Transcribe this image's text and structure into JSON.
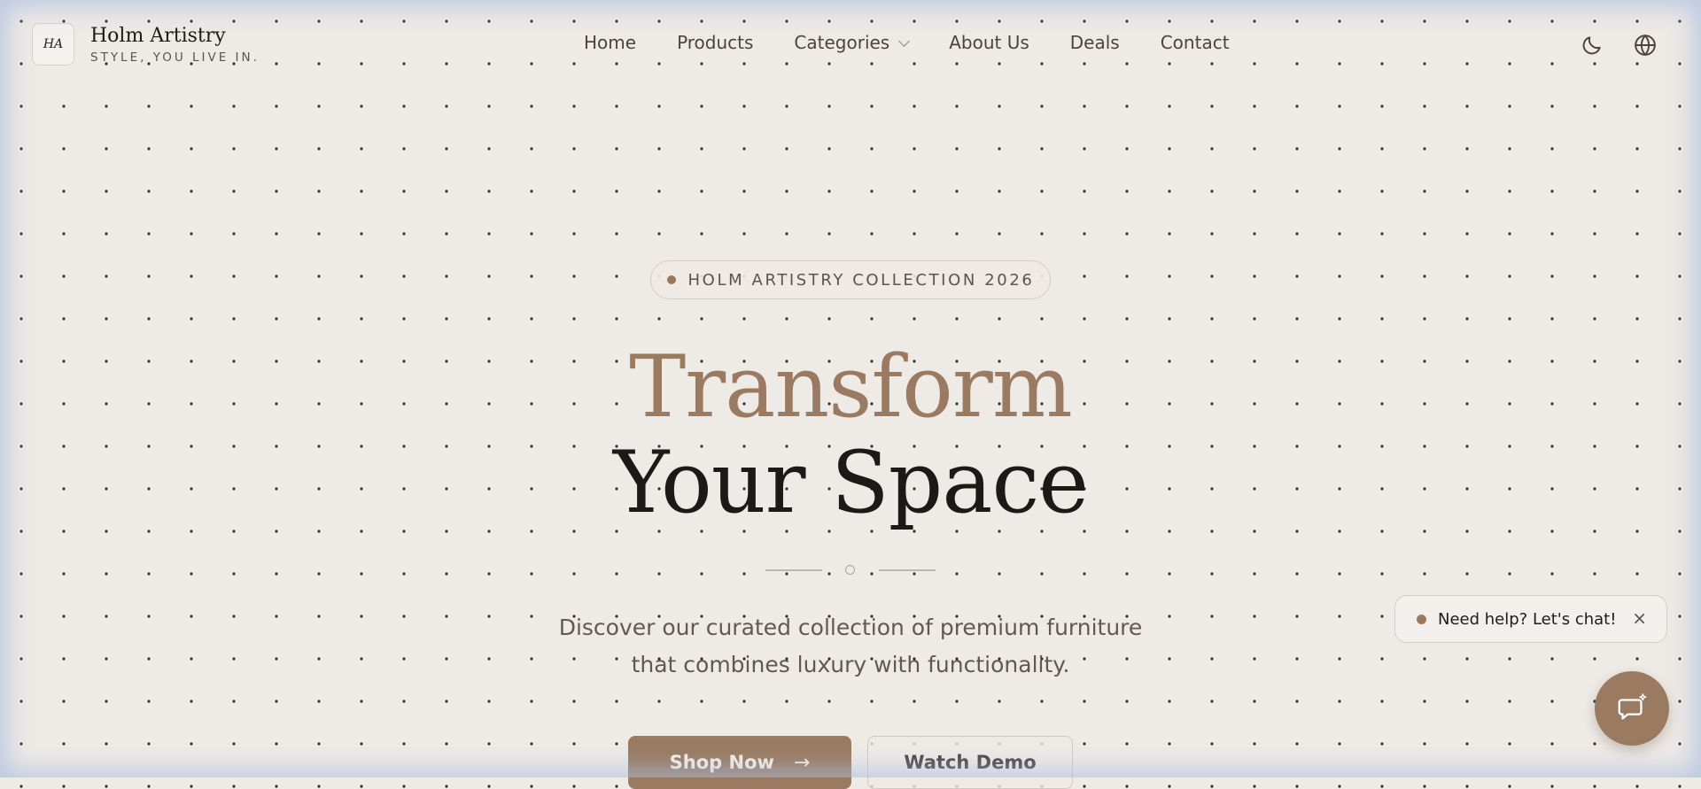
{
  "brand": {
    "logo_text": "HA",
    "name": "Holm Artistry",
    "tagline": "STYLE, YOU LIVE IN."
  },
  "nav": {
    "items": [
      {
        "label": "Home"
      },
      {
        "label": "Products"
      },
      {
        "label": "Categories",
        "has_dropdown": true
      },
      {
        "label": "About Us"
      },
      {
        "label": "Deals"
      },
      {
        "label": "Contact"
      }
    ]
  },
  "header_icons": [
    "moon-icon",
    "globe-icon"
  ],
  "hero": {
    "badge": "HOLM ARTISTRY COLLECTION 2026",
    "title_line1": "Transform",
    "title_line2": "Your Space",
    "subtitle_line1": "Discover our curated collection of premium furniture",
    "subtitle_line2": "that combines luxury with functionality.",
    "primary_button": "Shop Now",
    "secondary_button": "Watch Demo"
  },
  "chat": {
    "prompt": "Need help? Let's chat!",
    "close_symbol": "×"
  },
  "colors": {
    "accent": "#9a7a60",
    "background": "#eeeae6",
    "text_dark": "#1c1a18",
    "text_muted": "#5f5955"
  }
}
